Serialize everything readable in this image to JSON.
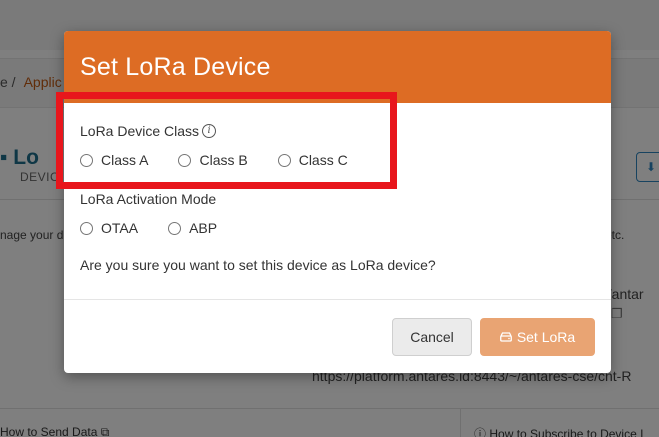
{
  "background": {
    "breadcrumb": {
      "home_sep": "e /",
      "link": "Applic"
    },
    "device": {
      "title_fragment": "Lo",
      "subtitle_fragment": "DEVIC"
    },
    "description_fragment": "nage your d",
    "etc_fragment": "etc.",
    "url_fragment_1": "e/antar",
    "url_fragment_2": "https://platform.antares.id:8443/~/antares-cse/cnt-R",
    "footer": {
      "left_link": "How to Send Data",
      "right_link": "How to Subscribe to Device I"
    }
  },
  "modal": {
    "title": "Set LoRa Device",
    "device_class": {
      "label": "LoRa Device Class",
      "info_icon": "info-icon",
      "options": [
        "Class A",
        "Class B",
        "Class C"
      ]
    },
    "activation_mode": {
      "label": "LoRa Activation Mode",
      "options": [
        "OTAA",
        "ABP"
      ]
    },
    "confirm_text": "Are you sure you want to set this device as LoRa device?",
    "buttons": {
      "cancel": "Cancel",
      "set_lora": "Set LoRa",
      "set_lora_icon": "drive-icon"
    }
  },
  "colors": {
    "header_orange": "#dd6c24",
    "set_button_disabled": "#e9a473",
    "highlight_red": "#e8161c",
    "brand_link": "#c25a13"
  }
}
